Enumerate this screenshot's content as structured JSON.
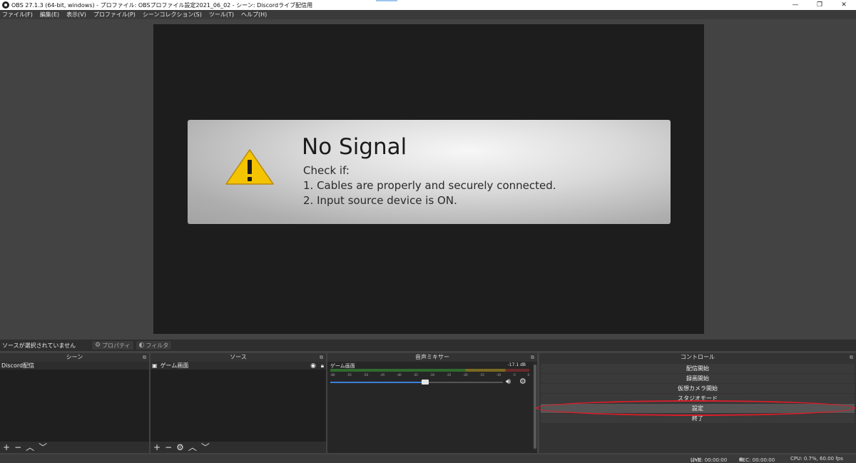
{
  "window": {
    "title": "OBS 27.1.3 (64-bit, windows) - プロファイル: OBSプロファイル設定2021_06_02 - シーン: Discordライブ配信用",
    "minimize": "—",
    "maximize": "❐",
    "close": "✕"
  },
  "menu": [
    "ファイル(F)",
    "編集(E)",
    "表示(V)",
    "プロファイル(P)",
    "シーンコレクション(S)",
    "ツール(T)",
    "ヘルプ(H)"
  ],
  "preview": {
    "title": "No Signal",
    "line1": "Check if:",
    "line2": "1. Cables are properly and securely connected.",
    "line3": "2. Input source device is ON.",
    "warning_icon": "warning-triangle-icon",
    "warning_color": "#f5c400"
  },
  "source_toolbar": {
    "no_source": "ソースが選択されていません",
    "properties": "プロパティ",
    "filters": "フィルタ"
  },
  "docks": {
    "scenes": {
      "title": "シーン",
      "items": [
        "Discord配信"
      ]
    },
    "sources": {
      "title": "ソース",
      "items": [
        "ゲーム画面"
      ]
    },
    "mixer": {
      "title": "音声ミキサー",
      "channel": "ゲーム画面",
      "level": "-17.1 dB",
      "volume_percent": 55
    },
    "controls": {
      "title": "コントロール",
      "buttons": [
        "配信開始",
        "録画開始",
        "仮想カメラ開始",
        "スタジオモード",
        "設定",
        "終了"
      ]
    }
  },
  "status": {
    "live": "LIVE: 00:00:00",
    "rec": "REC: 00:00:00",
    "cpu": "CPU: 0.7%, 60.00 fps"
  },
  "annotation_color": "#d81e2a"
}
